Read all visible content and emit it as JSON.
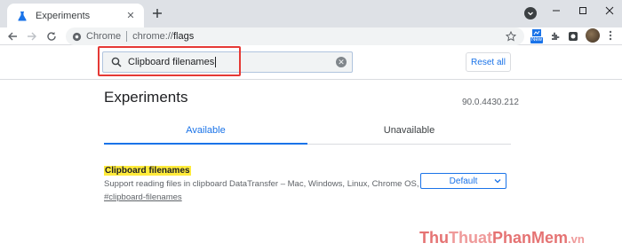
{
  "browser": {
    "tab_title": "Experiments",
    "site_label": "Chrome",
    "url_scheme": "chrome://",
    "url_path": "flags",
    "extension_badge": "New"
  },
  "header": {
    "search_value": "Clipboard filenames",
    "reset_label": "Reset all"
  },
  "main": {
    "title": "Experiments",
    "version": "90.0.4430.212",
    "tabs": [
      {
        "label": "Available",
        "active": true
      },
      {
        "label": "Unavailable",
        "active": false
      }
    ],
    "flag": {
      "name": "Clipboard filenames",
      "description": "Support reading files in clipboard DataTransfer – Mac, Windows, Linux, Chrome OS, Android",
      "link": "#clipboard-filenames",
      "select_value": "Default"
    }
  },
  "watermark": {
    "part1": "Thu",
    "part2": "Thuat",
    "part3": "PhanMem",
    "part4": ".vn"
  },
  "colors": {
    "accent": "#1a73e8",
    "highlight": "#ffeb3b",
    "annotation": "#e53935"
  }
}
